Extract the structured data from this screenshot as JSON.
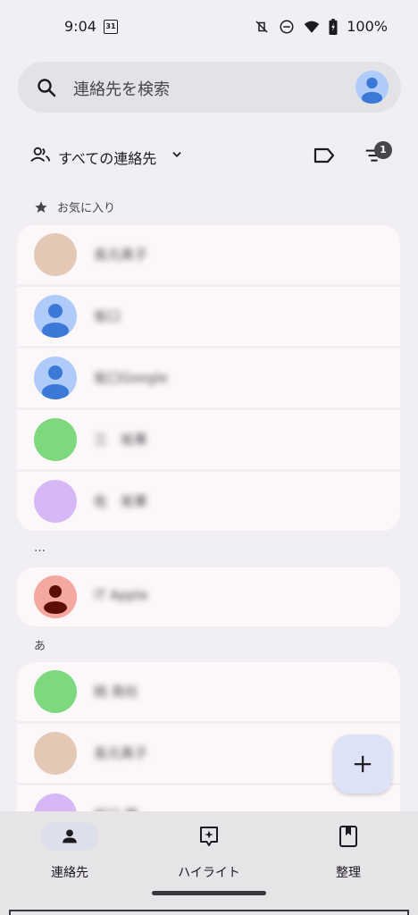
{
  "status_bar": {
    "time": "9:04",
    "calendar_day": "31",
    "battery": "100%"
  },
  "search": {
    "placeholder": "連絡先を検索"
  },
  "filter": {
    "label": "すべての連絡先",
    "sort_badge": "1"
  },
  "sections": {
    "favorites": "お気に入り",
    "ellipsis": "…",
    "a_section": "あ"
  },
  "favorites": [
    {
      "name": "長元真子",
      "avatar": "photo"
    },
    {
      "name": "坂口",
      "avatar": "default-blue"
    },
    {
      "name": "坂口Google",
      "avatar": "default-blue"
    },
    {
      "name": "三　坂果",
      "avatar": "green"
    },
    {
      "name": "佐　坂果",
      "avatar": "purple"
    }
  ],
  "misc_contacts": [
    {
      "name": "iT Apple",
      "avatar": "red-person"
    }
  ],
  "a_contacts": [
    {
      "name": "桃 商社",
      "avatar": "green"
    },
    {
      "name": "長元真子",
      "avatar": "photo"
    },
    {
      "name": "坂口 雅",
      "avatar": "purple"
    }
  ],
  "fab": {
    "icon": "plus-icon"
  },
  "bottom_nav": [
    {
      "label": "連絡先",
      "icon": "person-icon",
      "active": true
    },
    {
      "label": "ハイライト",
      "icon": "highlight-icon",
      "active": false
    },
    {
      "label": "整理",
      "icon": "bookmark-icon",
      "active": false
    }
  ],
  "colors": {
    "background": "#F1EFF3",
    "card": "#FCF8F9",
    "avatar_blue": "#AECBFA",
    "avatar_blue_person": "#3C78D8",
    "avatar_green": "#7DD87E",
    "avatar_purple": "#D7B8F6",
    "avatar_red": "#F4A8A0",
    "avatar_photo": "#E3C8B5",
    "fab": "#DDE2F7"
  }
}
